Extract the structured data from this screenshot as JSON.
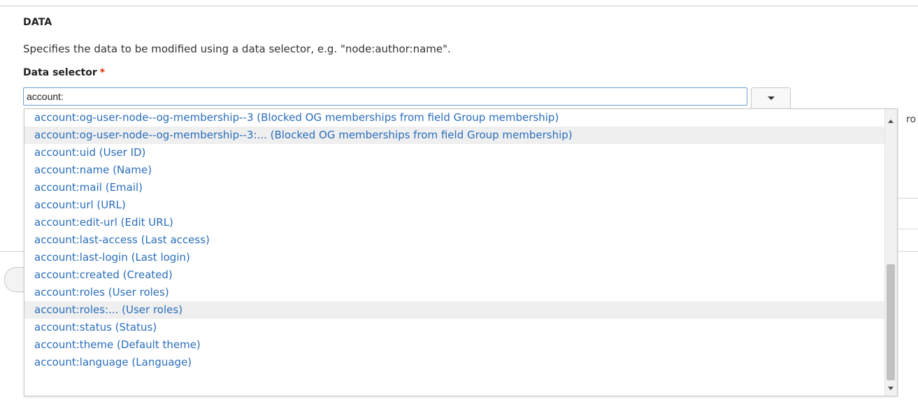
{
  "section": {
    "title": "DATA",
    "description": "Specifies the data to be modified using a data selector, e.g. \"node:author:name\"."
  },
  "field": {
    "label": "Data selector",
    "required_marker": "*",
    "value": "account:"
  },
  "background": {
    "clipped_text": "ro"
  },
  "autocomplete": {
    "items": [
      {
        "label": "account:og-user-node--og-membership--3 (Blocked OG memberships from field Group membership)",
        "highlighted": false
      },
      {
        "label": "account:og-user-node--og-membership--3:... (Blocked OG memberships from field Group membership)",
        "highlighted": true
      },
      {
        "label": "account:uid (User ID)",
        "highlighted": false
      },
      {
        "label": "account:name (Name)",
        "highlighted": false
      },
      {
        "label": "account:mail (Email)",
        "highlighted": false
      },
      {
        "label": "account:url (URL)",
        "highlighted": false
      },
      {
        "label": "account:edit-url (Edit URL)",
        "highlighted": false
      },
      {
        "label": "account:last-access (Last access)",
        "highlighted": false
      },
      {
        "label": "account:last-login (Last login)",
        "highlighted": false
      },
      {
        "label": "account:created (Created)",
        "highlighted": false
      },
      {
        "label": "account:roles (User roles)",
        "highlighted": false
      },
      {
        "label": "account:roles:... (User roles)",
        "highlighted": true
      },
      {
        "label": "account:status (Status)",
        "highlighted": false
      },
      {
        "label": "account:theme (Default theme)",
        "highlighted": false
      },
      {
        "label": "account:language (Language)",
        "highlighted": false
      }
    ]
  },
  "colors": {
    "link": "#2a6ebb",
    "required": "#e32700",
    "highlight_row": "#efefef"
  },
  "icons": {
    "toggle": "caret-down",
    "scroll_up": "arrow-up",
    "scroll_down": "arrow-down"
  }
}
